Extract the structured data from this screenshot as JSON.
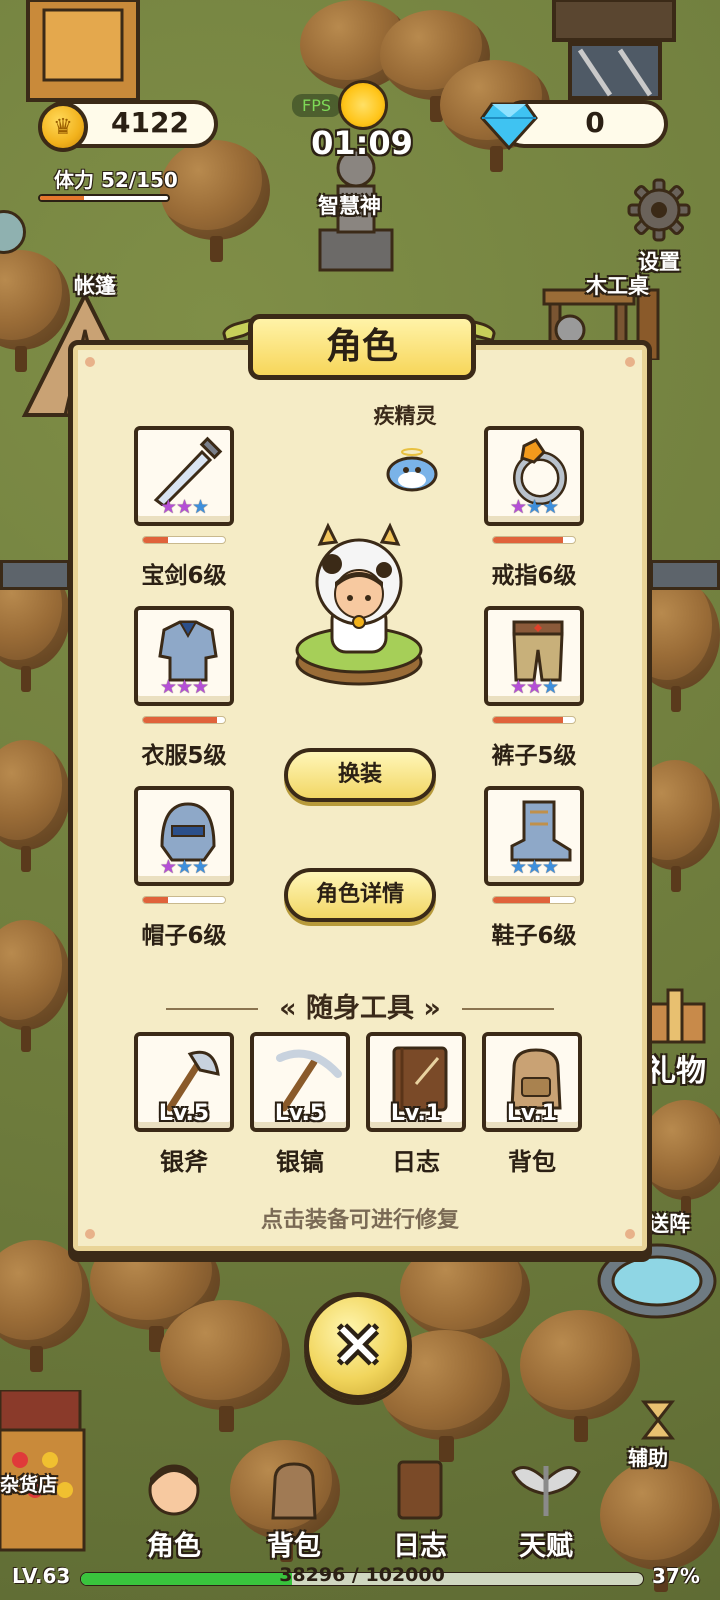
{
  "hud": {
    "coins": "4122",
    "gems": "0",
    "stamina_label": "体力 52/150",
    "stamina_fraction": 0.347,
    "fps": "FPS",
    "clock": "01:09"
  },
  "world_labels": {
    "statue": "智慧神",
    "tent": "帐篷",
    "workbench": "木工桌",
    "settings": "设置",
    "gift": "礼物",
    "portal": "送阵",
    "grocery": "杂货店",
    "assist": "辅助"
  },
  "panel": {
    "title": "角色",
    "spirit_name": "疾精灵",
    "equipment": [
      {
        "label": "宝剑6级",
        "icon": "sword-icon",
        "stars": [
          "purple",
          "purple",
          "blue"
        ],
        "durability": 0.3
      },
      {
        "label": "戒指6级",
        "icon": "ring-icon",
        "stars": [
          "purple",
          "blue",
          "blue"
        ],
        "durability": 0.85
      },
      {
        "label": "衣服5级",
        "icon": "armor-icon",
        "stars": [
          "purple",
          "purple",
          "purple"
        ],
        "durability": 0.9
      },
      {
        "label": "裤子5级",
        "icon": "pants-icon",
        "stars": [
          "purple",
          "purple",
          "blue"
        ],
        "durability": 0.85
      },
      {
        "label": "帽子6级",
        "icon": "helmet-icon",
        "stars": [
          "purple",
          "blue",
          "blue"
        ],
        "durability": 0.3
      },
      {
        "label": "鞋子6级",
        "icon": "boots-icon",
        "stars": [
          "blue",
          "blue",
          "blue"
        ],
        "durability": 0.7
      }
    ],
    "change_outfit_button": "换装",
    "details_button": "角色详情",
    "tools_title": "随身工具",
    "tools": [
      {
        "name": "银斧",
        "level": "Lv.5",
        "icon": "axe-icon"
      },
      {
        "name": "银镐",
        "level": "Lv.5",
        "icon": "pickaxe-icon"
      },
      {
        "name": "日志",
        "level": "Lv.1",
        "icon": "journal-icon"
      },
      {
        "name": "背包",
        "level": "Lv.1",
        "icon": "backpack-icon"
      }
    ],
    "hint": "点击装备可进行修复"
  },
  "close_icon": "close-icon",
  "nav": [
    {
      "label": "角色",
      "icon": "character-icon"
    },
    {
      "label": "背包",
      "icon": "backpack-icon"
    },
    {
      "label": "日志",
      "icon": "journal-icon"
    },
    {
      "label": "天赋",
      "icon": "wings-icon"
    }
  ],
  "xp": {
    "level": "LV.63",
    "progress": "38296 / 102000",
    "percent": "37%",
    "fraction": 0.375
  },
  "colors": {
    "panel_bg": "#f5ecc6",
    "outline": "#3b2a17",
    "star_purple": "#b44fd6",
    "star_blue": "#3e8fdc",
    "durability": "#e0623a",
    "xp_fill": "#39c43d",
    "stamina_fill": "#e5772d"
  }
}
